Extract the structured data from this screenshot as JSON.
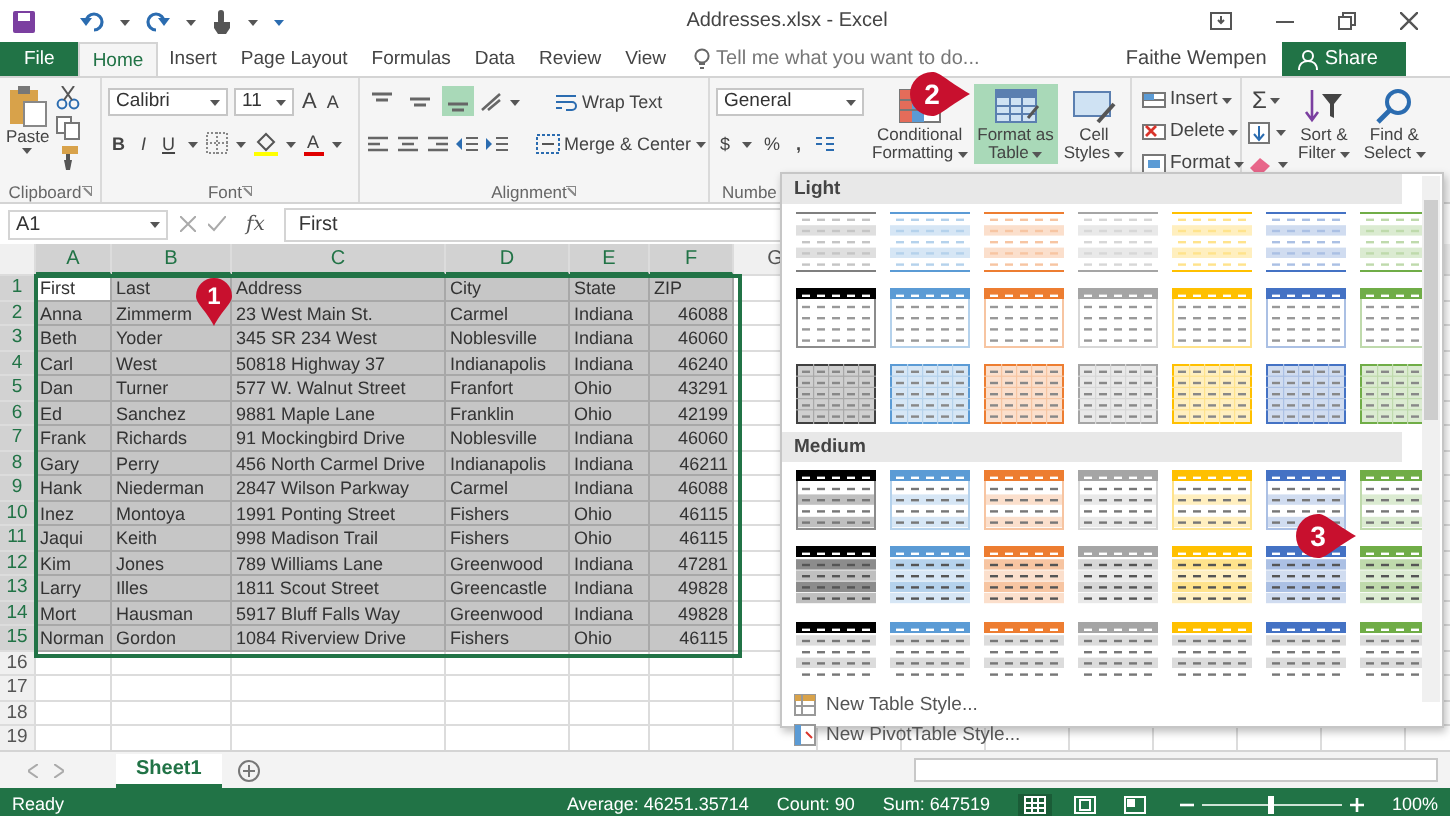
{
  "window": {
    "title": "Addresses.xlsx - Excel"
  },
  "ribbon_tabs": [
    {
      "label": "File",
      "kind": "file",
      "selected": false
    },
    {
      "label": "Home",
      "kind": "tab",
      "selected": true
    },
    {
      "label": "Insert",
      "kind": "tab",
      "selected": false
    },
    {
      "label": "Page Layout",
      "kind": "tab",
      "selected": false
    },
    {
      "label": "Formulas",
      "kind": "tab",
      "selected": false
    },
    {
      "label": "Data",
      "kind": "tab",
      "selected": false
    },
    {
      "label": "Review",
      "kind": "tab",
      "selected": false
    },
    {
      "label": "View",
      "kind": "tab",
      "selected": false
    }
  ],
  "tell_me": {
    "placeholder": "Tell me what you want to do..."
  },
  "account": {
    "user": "Faithe Wempen",
    "share": "Share"
  },
  "clipboard": {
    "paste": "Paste",
    "label": "Clipboard"
  },
  "font": {
    "name": "Calibri",
    "size": "11",
    "grow": "A",
    "shrink": "A",
    "bold": "B",
    "italic": "I",
    "underline": "U",
    "color_letter": "A",
    "label": "Font"
  },
  "alignment": {
    "vertical": [
      {
        "selected": false
      },
      {
        "selected": false
      },
      {
        "selected": true
      }
    ],
    "wrap": "Wrap Text",
    "merge": "Merge & Center",
    "label": "Alignment"
  },
  "number": {
    "format": "General",
    "currency": "$",
    "percent": "%",
    "comma": ",",
    "label": "Numbe"
  },
  "styles": [
    {
      "lines": [
        "Conditional",
        "Formatting"
      ],
      "kind": "conditional",
      "selected": false
    },
    {
      "lines": [
        "Format as",
        "Table"
      ],
      "kind": "table",
      "selected": true
    },
    {
      "lines": [
        "Cell",
        "Styles"
      ],
      "kind": "cell",
      "selected": false
    }
  ],
  "cells": [
    {
      "label": "Insert",
      "kind": "insert"
    },
    {
      "label": "Delete",
      "kind": "delete"
    },
    {
      "label": "Format",
      "kind": "format"
    }
  ],
  "editing": {
    "autosum": "Σ",
    "buttons": [
      {
        "lines": [
          "Sort &",
          "Filter"
        ],
        "kind": "sort"
      },
      {
        "lines": [
          "Find &",
          "Select"
        ],
        "kind": "find"
      }
    ]
  },
  "formula_bar": {
    "name_box": "A1",
    "function_label": "fx",
    "content": "First"
  },
  "sheet": {
    "columns": [
      {
        "label": "A",
        "selected": true
      },
      {
        "label": "B",
        "selected": true
      },
      {
        "label": "C",
        "selected": true
      },
      {
        "label": "D",
        "selected": true
      },
      {
        "label": "E",
        "selected": true
      },
      {
        "label": "F",
        "selected": true
      },
      {
        "label": "G",
        "selected": false
      }
    ],
    "rows": [
      {
        "number": "1",
        "selected": true,
        "cells": [
          "First",
          "Last",
          "Address",
          "City",
          "State",
          "ZIP"
        ]
      },
      {
        "number": "2",
        "selected": true,
        "cells": [
          "Anna",
          "Zimmerm",
          "23 West Main St.",
          "Carmel",
          "Indiana",
          "46088"
        ]
      },
      {
        "number": "3",
        "selected": true,
        "cells": [
          "Beth",
          "Yoder",
          "345 SR 234 West",
          "Noblesville",
          "Indiana",
          "46060"
        ]
      },
      {
        "number": "4",
        "selected": true,
        "cells": [
          "Carl",
          "West",
          "50818 Highway 37",
          "Indianapolis",
          "Indiana",
          "46240"
        ]
      },
      {
        "number": "5",
        "selected": true,
        "cells": [
          "Dan",
          "Turner",
          "577 W. Walnut Street",
          "Franfort",
          "Ohio",
          "43291"
        ]
      },
      {
        "number": "6",
        "selected": true,
        "cells": [
          "Ed",
          "Sanchez",
          "9881 Maple Lane",
          "Franklin",
          "Ohio",
          "42199"
        ]
      },
      {
        "number": "7",
        "selected": true,
        "cells": [
          "Frank",
          "Richards",
          "91 Mockingbird Drive",
          "Noblesville",
          "Indiana",
          "46060"
        ]
      },
      {
        "number": "8",
        "selected": true,
        "cells": [
          "Gary",
          "Perry",
          "456 North Carmel Drive",
          "Indianapolis",
          "Indiana",
          "46211"
        ]
      },
      {
        "number": "9",
        "selected": true,
        "cells": [
          "Hank",
          "Niederman",
          "2847 Wilson Parkway",
          "Carmel",
          "Indiana",
          "46088"
        ]
      },
      {
        "number": "10",
        "selected": true,
        "cells": [
          "Inez",
          "Montoya",
          "1991 Ponting Street",
          "Fishers",
          "Ohio",
          "46115"
        ]
      },
      {
        "number": "11",
        "selected": true,
        "cells": [
          "Jaqui",
          "Keith",
          "998 Madison Trail",
          "Fishers",
          "Ohio",
          "46115"
        ]
      },
      {
        "number": "12",
        "selected": true,
        "cells": [
          "Kim",
          "Jones",
          "789 Williams Lane",
          "Greenwood",
          "Indiana",
          "47281"
        ]
      },
      {
        "number": "13",
        "selected": true,
        "cells": [
          "Larry",
          "Illes",
          "1811 Scout Street",
          "Greencastle",
          "Indiana",
          "49828"
        ]
      },
      {
        "number": "14",
        "selected": true,
        "cells": [
          "Mort",
          "Hausman",
          "5917 Bluff Falls Way",
          "Greenwood",
          "Indiana",
          "49828"
        ]
      },
      {
        "number": "15",
        "selected": true,
        "cells": [
          "Norman",
          "Gordon",
          "1084 Riverview Drive",
          "Fishers",
          "Ohio",
          "46115"
        ]
      },
      {
        "number": "16",
        "selected": false
      },
      {
        "number": "17",
        "selected": false
      },
      {
        "number": "18",
        "selected": false
      },
      {
        "number": "19",
        "selected": false
      }
    ]
  },
  "sheet_tabs": [
    {
      "label": "Sheet1",
      "selected": true
    }
  ],
  "status": {
    "mode": "Ready",
    "stats": [
      "Average: 46251.35714",
      "Count: 90",
      "Sum: 647519"
    ],
    "views": [
      {
        "kind": "normal",
        "selected": true
      },
      {
        "kind": "page-layout",
        "selected": false
      },
      {
        "kind": "page-break",
        "selected": false
      }
    ],
    "zoom": {
      "level": 0.5,
      "label": "100%"
    }
  },
  "gallery": {
    "sections": [
      {
        "title": "Light",
        "rows": [
          {
            "kind": "lines",
            "styles": [
              {
                "color": "#7f7f7f"
              },
              {
                "color": "#5b9bd5"
              },
              {
                "color": "#ed7d31"
              },
              {
                "color": "#a5a5a5"
              },
              {
                "color": "#ffc000"
              },
              {
                "color": "#4472c4"
              },
              {
                "color": "#70ad47"
              }
            ]
          },
          {
            "kind": "header-outline",
            "styles": [
              {
                "color": "#000000"
              },
              {
                "color": "#5b9bd5"
              },
              {
                "color": "#ed7d31"
              },
              {
                "color": "#a5a5a5"
              },
              {
                "color": "#ffc000"
              },
              {
                "color": "#4472c4"
              },
              {
                "color": "#70ad47"
              }
            ]
          },
          {
            "kind": "grid",
            "styles": [
              {
                "color": "#404040"
              },
              {
                "color": "#5b9bd5"
              },
              {
                "color": "#ed7d31"
              },
              {
                "color": "#a5a5a5"
              },
              {
                "color": "#ffc000"
              },
              {
                "color": "#4472c4"
              },
              {
                "color": "#70ad47"
              }
            ]
          }
        ]
      },
      {
        "title": "Medium",
        "rows": [
          {
            "kind": "header",
            "styles": [
              {
                "color": "#000000"
              },
              {
                "color": "#5b9bd5"
              },
              {
                "color": "#ed7d31"
              },
              {
                "color": "#a5a5a5"
              },
              {
                "color": "#ffc000"
              },
              {
                "color": "#4472c4"
              },
              {
                "color": "#70ad47"
              }
            ]
          },
          {
            "kind": "banded",
            "styles": [
              {
                "color": "#000000"
              },
              {
                "color": "#5b9bd5"
              },
              {
                "color": "#ed7d31"
              },
              {
                "color": "#a5a5a5"
              },
              {
                "color": "#ffc000"
              },
              {
                "color": "#4472c4"
              },
              {
                "color": "#70ad47"
              }
            ]
          },
          {
            "kind": "header-bar",
            "styles": [
              {
                "color": "#000000"
              },
              {
                "color": "#5b9bd5"
              },
              {
                "color": "#ed7d31"
              },
              {
                "color": "#a5a5a5"
              },
              {
                "color": "#ffc000"
              },
              {
                "color": "#4472c4"
              },
              {
                "color": "#70ad47"
              }
            ]
          }
        ]
      }
    ],
    "menu": [
      {
        "label": "New Table Style...",
        "kind": "table"
      },
      {
        "label": "New PivotTable Style...",
        "kind": "pivot"
      }
    ]
  },
  "callouts": [
    {
      "number": "1",
      "kind": "down"
    },
    {
      "number": "2",
      "kind": "right"
    },
    {
      "number": "3",
      "kind": "right"
    }
  ]
}
